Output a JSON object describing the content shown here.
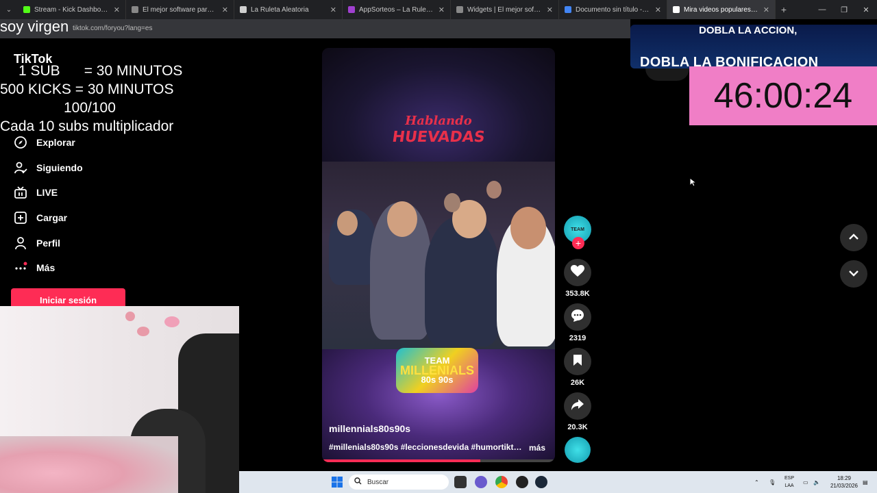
{
  "browser": {
    "tabs": [
      {
        "title": "Stream - Kick Dashboard",
        "color": "#53fc18"
      },
      {
        "title": "El mejor software para potencia",
        "color": "#888888"
      },
      {
        "title": "La Ruleta Aleatoria",
        "color": "#d0d0d0"
      },
      {
        "title": "AppSorteos – La Ruleta de la S",
        "color": "#a040d0"
      },
      {
        "title": "Widgets | El mejor software par",
        "color": "#888888"
      },
      {
        "title": "Documento sin título - Docum",
        "color": "#4285f4"
      },
      {
        "title": "Mira videos populares sele",
        "color": "#ffffff",
        "active": true
      }
    ],
    "url": "tiktok.com/foryou?lang=es"
  },
  "overlay": {
    "top_text": "soy virgen",
    "line1": "1 SUB      = 30 MINUTOS",
    "line2": "500 KICKS = 30 MINUTOS",
    "line3": "100/100",
    "line4": "Cada 10 subs multiplicador",
    "promo_line1": "DOBLA LA ACCION,",
    "promo_line2": "DOBLA LA BONIFICACION",
    "timer": "46:00:24"
  },
  "sidebar": {
    "logo": "TikTok",
    "items": [
      {
        "label": "Explorar",
        "icon": "compass-icon"
      },
      {
        "label": "Siguiendo",
        "icon": "following-icon"
      },
      {
        "label": "LIVE",
        "icon": "live-icon"
      },
      {
        "label": "Cargar",
        "icon": "upload-icon"
      },
      {
        "label": "Perfil",
        "icon": "profile-icon"
      },
      {
        "label": "Más",
        "icon": "more-icon"
      }
    ],
    "login_label": "Iniciar sesión"
  },
  "video": {
    "brand_line1": "Hablando",
    "brand_line2": "HUEVADAS",
    "badge_line1": "TEAM",
    "badge_line2": "MILLENIALS",
    "badge_line3": "80s 90s",
    "username": "millennials80s90s",
    "hashtags": "#millenials80s90s #leccionesdevida #humortikto...",
    "more_label": "más",
    "progress": 0.68
  },
  "actions": {
    "likes": "353.8K",
    "comments": "2319",
    "saves": "26K",
    "shares": "20.3K"
  },
  "taskbar": {
    "search_placeholder": "Buscar",
    "lang_line1": "ESP",
    "lang_line2": "LAA",
    "time": "18:29",
    "date": "21/03/2026"
  }
}
